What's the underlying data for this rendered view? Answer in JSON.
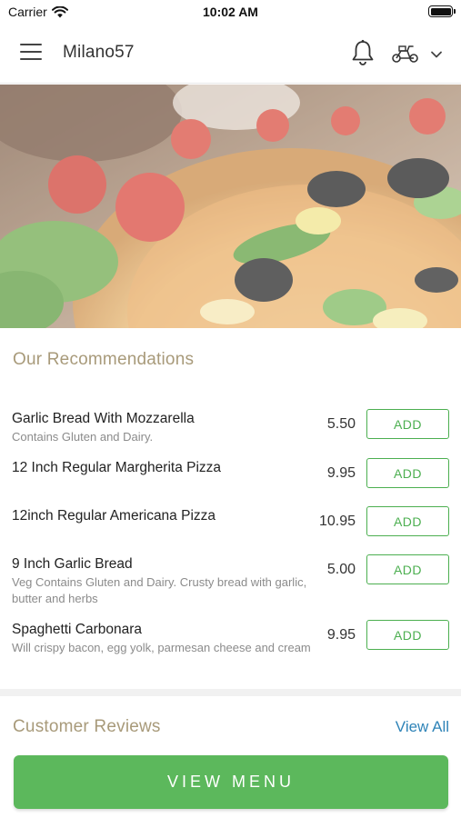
{
  "status_bar": {
    "carrier": "Carrier",
    "time": "10:02 AM"
  },
  "nav": {
    "title": "Milano57"
  },
  "recommendations": {
    "title": "Our Recommendations",
    "items": [
      {
        "name": "Garlic Bread With Mozzarella",
        "description": "Contains Gluten and Dairy.",
        "price": "5.50",
        "button": "ADD"
      },
      {
        "name": "12 Inch Regular Margherita Pizza",
        "description": "",
        "price": "9.95",
        "button": "ADD"
      },
      {
        "name": "12inch Regular Americana Pizza",
        "description": "",
        "price": "10.95",
        "button": "ADD"
      },
      {
        "name": "9 Inch Garlic Bread",
        "description": "Veg Contains Gluten and Dairy. Crusty bread with garlic, butter and herbs",
        "price": "5.00",
        "button": "ADD"
      },
      {
        "name": "Spaghetti Carbonara",
        "description": "Will crispy bacon, egg yolk, parmesan cheese and cream",
        "price": "9.95",
        "button": "ADD"
      }
    ]
  },
  "reviews": {
    "title": "Customer Reviews",
    "view_all": "View All"
  },
  "footer": {
    "view_menu": "VIEW MENU"
  },
  "colors": {
    "accent_green": "#5cb85c",
    "section_title": "#a89a7a",
    "link_blue": "#2f84b8"
  }
}
